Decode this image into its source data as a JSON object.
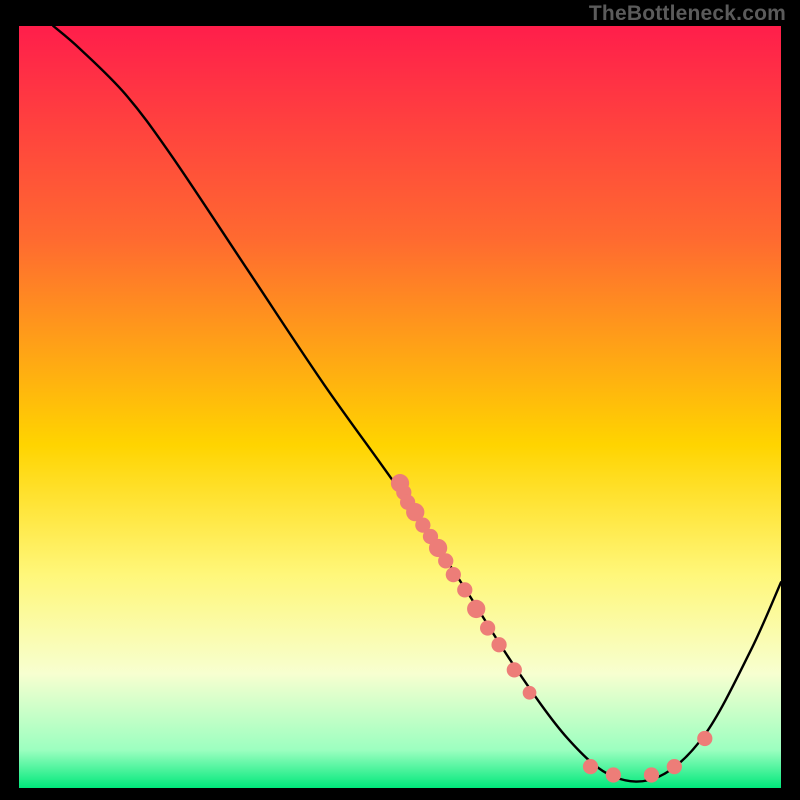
{
  "attribution": "TheBottleneck.com",
  "chart_data": {
    "type": "line",
    "title": "",
    "xlabel": "",
    "ylabel": "",
    "xlim": [
      0,
      100
    ],
    "ylim": [
      0,
      100
    ],
    "gradient_stops": [
      {
        "offset": 0,
        "color": "#ff1e4b"
      },
      {
        "offset": 28,
        "color": "#ff6a30"
      },
      {
        "offset": 55,
        "color": "#ffd400"
      },
      {
        "offset": 72,
        "color": "#fff77a"
      },
      {
        "offset": 85,
        "color": "#f7ffd0"
      },
      {
        "offset": 95,
        "color": "#9cffc0"
      },
      {
        "offset": 100,
        "color": "#00e87b"
      }
    ],
    "curve": [
      {
        "x": 4.5,
        "y": 100
      },
      {
        "x": 8,
        "y": 97
      },
      {
        "x": 14,
        "y": 91
      },
      {
        "x": 20,
        "y": 83
      },
      {
        "x": 30,
        "y": 68
      },
      {
        "x": 40,
        "y": 53
      },
      {
        "x": 50,
        "y": 39
      },
      {
        "x": 58,
        "y": 27
      },
      {
        "x": 65,
        "y": 16
      },
      {
        "x": 72,
        "y": 6.5
      },
      {
        "x": 78,
        "y": 1.5
      },
      {
        "x": 84,
        "y": 1.5
      },
      {
        "x": 90,
        "y": 7
      },
      {
        "x": 96,
        "y": 18
      },
      {
        "x": 100,
        "y": 27
      }
    ],
    "points": [
      {
        "x": 50,
        "y": 40.0,
        "r": 1.2
      },
      {
        "x": 50.5,
        "y": 38.8,
        "r": 1.0
      },
      {
        "x": 51,
        "y": 37.5,
        "r": 1.0
      },
      {
        "x": 52,
        "y": 36.2,
        "r": 1.2
      },
      {
        "x": 53,
        "y": 34.5,
        "r": 1.0
      },
      {
        "x": 54,
        "y": 33.0,
        "r": 1.0
      },
      {
        "x": 55,
        "y": 31.5,
        "r": 1.2
      },
      {
        "x": 56,
        "y": 29.8,
        "r": 1.0
      },
      {
        "x": 57,
        "y": 28.0,
        "r": 1.0
      },
      {
        "x": 58.5,
        "y": 26.0,
        "r": 1.0
      },
      {
        "x": 60,
        "y": 23.5,
        "r": 1.2
      },
      {
        "x": 61.5,
        "y": 21.0,
        "r": 1.0
      },
      {
        "x": 63,
        "y": 18.8,
        "r": 1.0
      },
      {
        "x": 65,
        "y": 15.5,
        "r": 1.0
      },
      {
        "x": 67,
        "y": 12.5,
        "r": 0.9
      },
      {
        "x": 75,
        "y": 2.8,
        "r": 1.0
      },
      {
        "x": 78,
        "y": 1.7,
        "r": 1.0
      },
      {
        "x": 83,
        "y": 1.7,
        "r": 1.0
      },
      {
        "x": 86,
        "y": 2.8,
        "r": 1.0
      },
      {
        "x": 90,
        "y": 6.5,
        "r": 1.0
      }
    ]
  }
}
